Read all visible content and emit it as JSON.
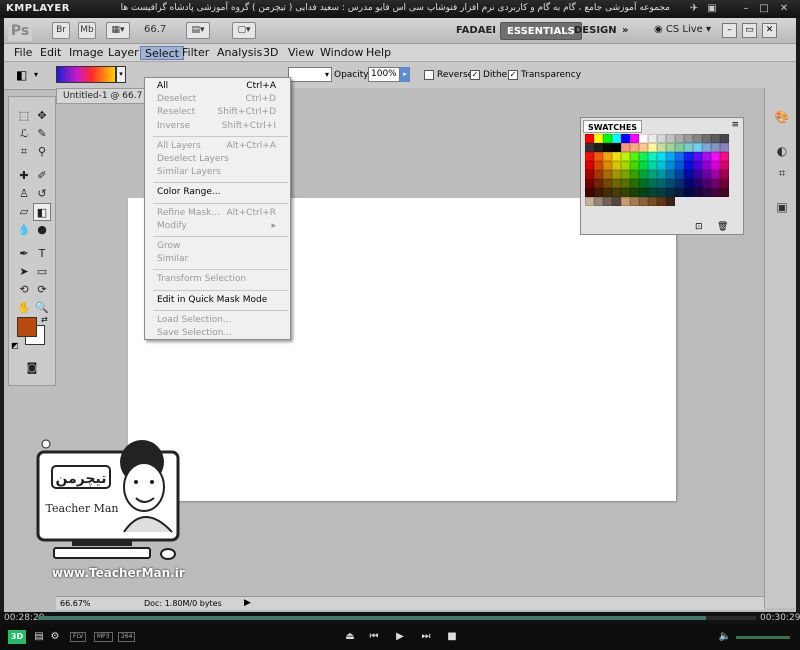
{
  "player": {
    "logo": "KMPLAYER",
    "caption": "مجموعه آموزشی جامع ، گام به گام و کاربردی نرم افزار فتوشاپ سی اس فایو  مدرس : سعید فدایی ( تیچرمن ) گروه آموزشی پادشاه گرافیست ها",
    "time_elapsed": "00:28:29",
    "time_total": "00:30:29",
    "progress": 0.93,
    "tags": [
      "FLV",
      "MP3",
      "264"
    ]
  },
  "appbar": {
    "ps_logo": "Ps",
    "br": "Br",
    "mb": "Mb",
    "zoom": "66.7",
    "workspaces": [
      "FADAEI",
      "ESSENTIALS",
      "DESIGN"
    ],
    "active_workspace": "ESSENTIALS",
    "cs_live": "CS Live"
  },
  "menubar": [
    "File",
    "Edit",
    "Image",
    "Layer",
    "Select",
    "Filter",
    "Analysis",
    "3D",
    "View",
    "Window",
    "Help"
  ],
  "options": {
    "opacity_label": "Opacity:",
    "opacity_value": "100%",
    "reverse": "Reverse",
    "dither": "Dither",
    "transparency": "Transparency",
    "reverse_checked": false,
    "dither_checked": true,
    "transparency_checked": true
  },
  "document": {
    "tab": "Untitled-1 @ 66.7",
    "status_zoom": "66.67%",
    "doc_size": "Doc: 1.80M/0 bytes"
  },
  "swatches": {
    "title": "SWATCHES"
  },
  "select_menu": [
    {
      "label": "All",
      "shortcut": "Ctrl+A",
      "enabled": true
    },
    {
      "label": "Deselect",
      "shortcut": "Ctrl+D",
      "enabled": false
    },
    {
      "label": "Reselect",
      "shortcut": "Shift+Ctrl+D",
      "enabled": false
    },
    {
      "label": "Inverse",
      "shortcut": "Shift+Ctrl+I",
      "enabled": false
    },
    {
      "sep": true
    },
    {
      "label": "All Layers",
      "shortcut": "Alt+Ctrl+A",
      "enabled": false
    },
    {
      "label": "Deselect Layers",
      "shortcut": "",
      "enabled": false
    },
    {
      "label": "Similar Layers",
      "shortcut": "",
      "enabled": false
    },
    {
      "sep": true
    },
    {
      "label": "Color Range...",
      "shortcut": "",
      "enabled": true
    },
    {
      "sep": true
    },
    {
      "label": "Refine Mask...",
      "shortcut": "Alt+Ctrl+R",
      "enabled": false
    },
    {
      "label": "Modify",
      "shortcut": "▸",
      "enabled": false
    },
    {
      "sep": true
    },
    {
      "label": "Grow",
      "shortcut": "",
      "enabled": false
    },
    {
      "label": "Similar",
      "shortcut": "",
      "enabled": false
    },
    {
      "sep": true
    },
    {
      "label": "Transform Selection",
      "shortcut": "",
      "enabled": false
    },
    {
      "sep": true
    },
    {
      "label": "Edit in Quick Mask Mode",
      "shortcut": "",
      "enabled": true
    },
    {
      "sep": true
    },
    {
      "label": "Load Selection...",
      "shortcut": "",
      "enabled": false
    },
    {
      "label": "Save Selection...",
      "shortcut": "",
      "enabled": false
    }
  ],
  "watermark": {
    "name": "Teacher Man",
    "url": "www.TeacherMan.ir"
  },
  "colors": {
    "foreground": "#b84a0d",
    "background": "#ffffff"
  }
}
